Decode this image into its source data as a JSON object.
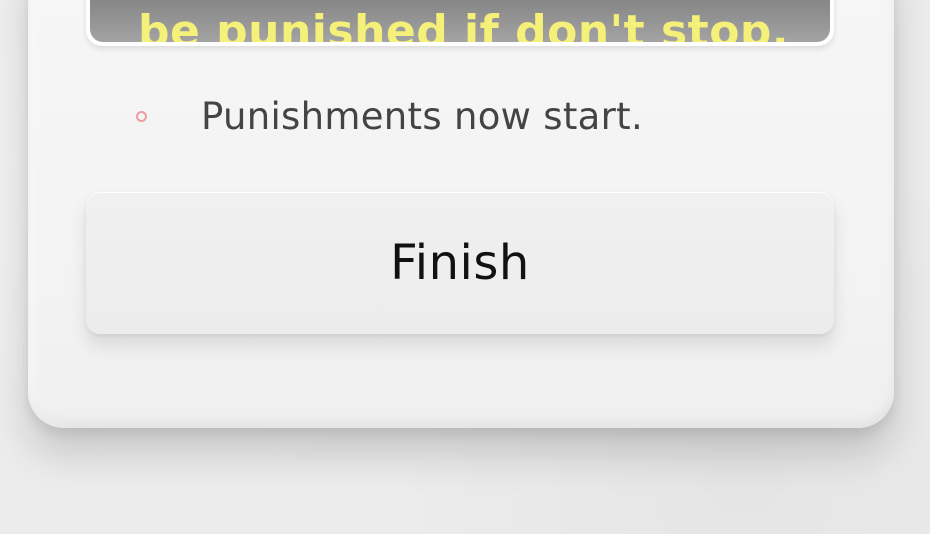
{
  "message": {
    "text": "be punished if don't stop."
  },
  "status": {
    "text": "Punishments now start.",
    "indicator_color": "#f09aa2"
  },
  "finish_button": {
    "label": "Finish"
  },
  "colors": {
    "message_text": "#f4f07a",
    "background": "#ececec"
  }
}
